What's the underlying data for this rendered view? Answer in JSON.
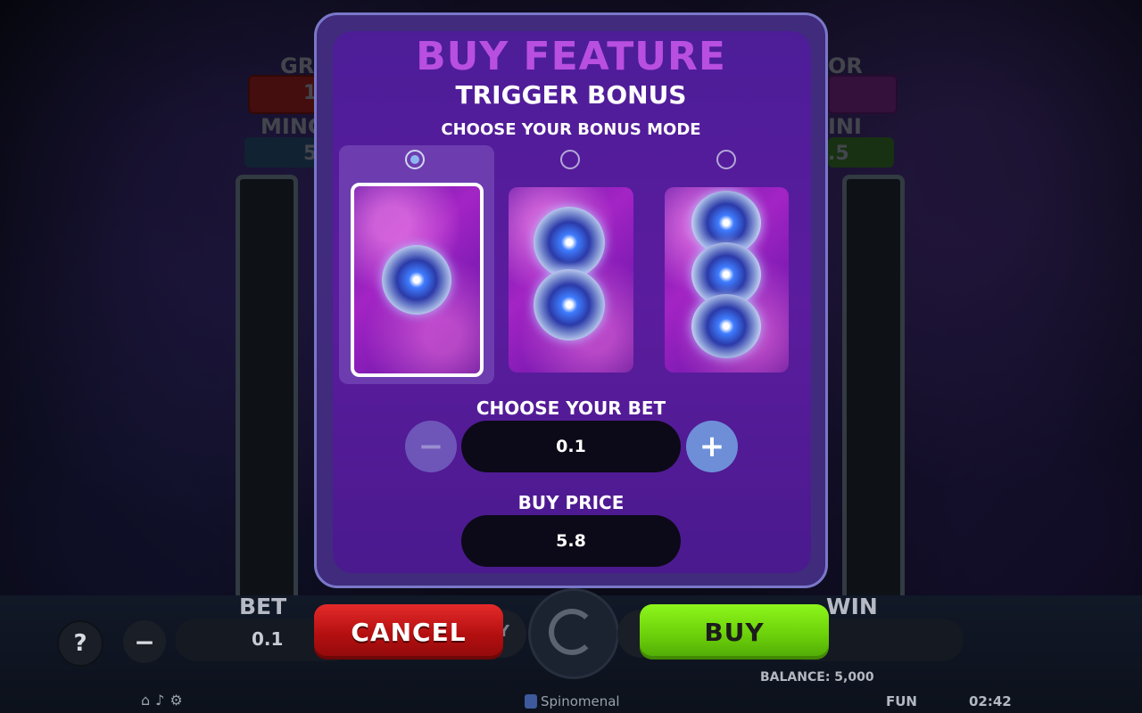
{
  "background": {
    "jackpots": {
      "grand_label": "GR",
      "grand_value": "1",
      "major_label": "OR",
      "minor_label": "MINC",
      "minor_value": "5",
      "mini_label": "INI",
      "mini_value": ".5"
    },
    "bottom_bar": {
      "help_label": "?",
      "minus_label": "−",
      "bet_label": "BET",
      "bet_value": "0.1",
      "auto_label": "Y",
      "win_label": "WIN",
      "balance": "BALANCE: 5,000",
      "mode": "FUN",
      "time": "02:42",
      "brand": "Spinomenal"
    }
  },
  "modal": {
    "title": "BUY FEATURE",
    "subtitle": "TRIGGER BONUS",
    "mode_label": "CHOOSE YOUR BONUS MODE",
    "options": [
      {
        "orbs": 1,
        "selected": true
      },
      {
        "orbs": 2,
        "selected": false
      },
      {
        "orbs": 3,
        "selected": false
      }
    ],
    "bet_label": "CHOOSE YOUR BET",
    "bet_value": "0.1",
    "minus_label": "−",
    "plus_label": "+",
    "price_label": "BUY PRICE",
    "price_value": "5.8"
  },
  "actions": {
    "cancel_label": "CANCEL",
    "buy_label": "BUY"
  },
  "colors": {
    "title": "#b84fe0",
    "cancel": "#c41818",
    "buy": "#76d80c",
    "modal_bg": "#531c9a"
  }
}
